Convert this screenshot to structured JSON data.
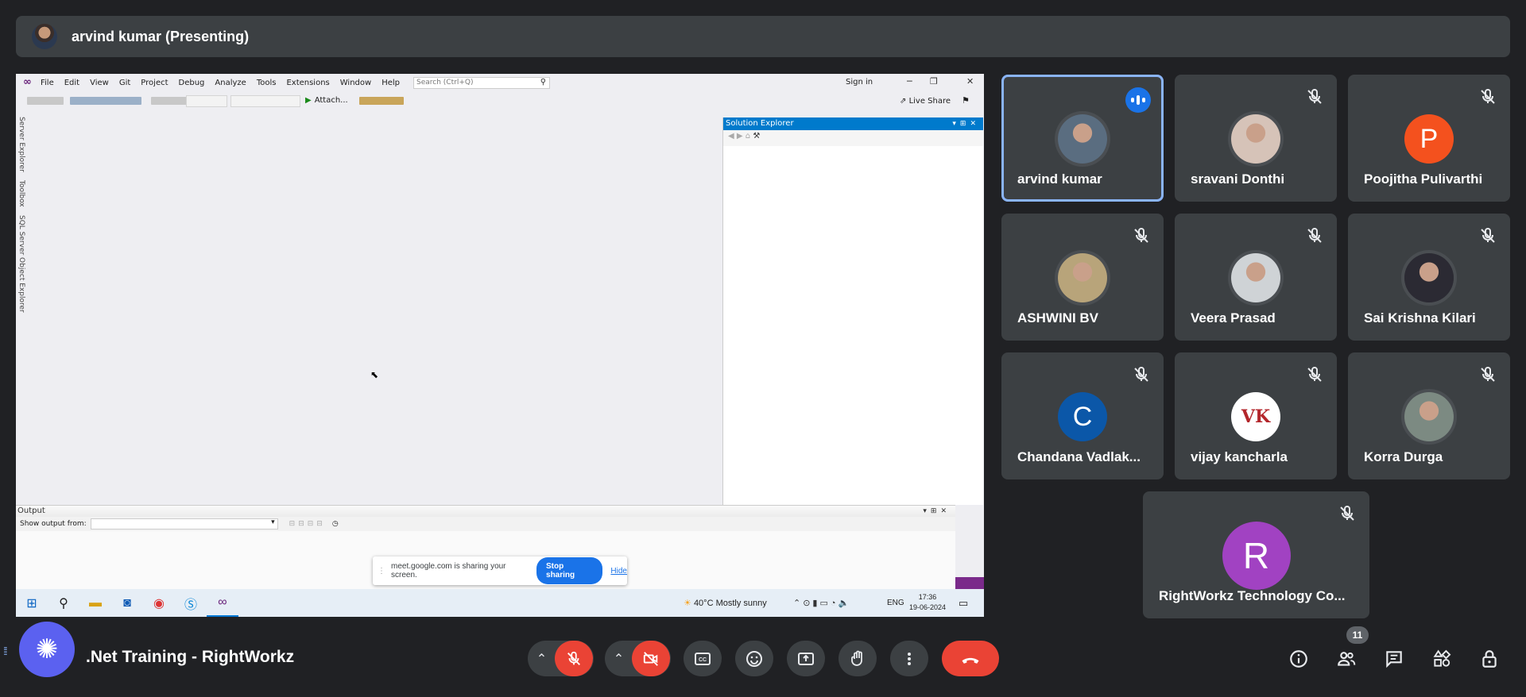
{
  "presenter": {
    "label": "arvind kumar (Presenting)"
  },
  "vs": {
    "menu": [
      "File",
      "Edit",
      "View",
      "Git",
      "Project",
      "Debug",
      "Analyze",
      "Tools",
      "Extensions",
      "Window",
      "Help"
    ],
    "search_placeholder": "Search (Ctrl+Q)",
    "sign_in": "Sign in",
    "attach": "Attach...",
    "live_share": "Live Share",
    "side_tabs": [
      "Server Explorer",
      "Toolbox",
      "SQL Server Object Explorer"
    ],
    "solution_explorer_title": "Solution Explorer",
    "output_title": "Output",
    "show_output_from": "Show output from:"
  },
  "share_notice": {
    "text": "meet.google.com is sharing your screen.",
    "stop_label": "Stop sharing",
    "hide_label": "Hide"
  },
  "taskbar": {
    "weather_temp": "40°C",
    "weather_text": "Mostly sunny",
    "language": "ENG",
    "time": "17:36",
    "date": "19-06-2024"
  },
  "participants": [
    {
      "name": "arvind kumar",
      "speaking": true,
      "avatar": "photo",
      "color": "#5a6d80"
    },
    {
      "name": "sravani Donthi",
      "speaking": false,
      "avatar": "photo",
      "color": "#d6c3b8"
    },
    {
      "name": "Poojitha Pulivarthi",
      "speaking": false,
      "avatar": "letter",
      "letter": "P",
      "color": "#f4511e"
    },
    {
      "name": "ASHWINI BV",
      "speaking": false,
      "avatar": "photo",
      "color": "#b8a47a"
    },
    {
      "name": "Veera Prasad",
      "speaking": false,
      "avatar": "photo",
      "color": "#cfd3d6"
    },
    {
      "name": "Sai Krishna Kilari",
      "speaking": false,
      "avatar": "photo",
      "color": "#2b2a33"
    },
    {
      "name": "Chandana Vadlak...",
      "speaking": false,
      "avatar": "letter",
      "letter": "C",
      "color": "#0b57a8"
    },
    {
      "name": "vijay kancharla",
      "speaking": false,
      "avatar": "logo",
      "letter": "VK",
      "color": "#ffffff"
    },
    {
      "name": "Korra Durga",
      "speaking": false,
      "avatar": "photo",
      "color": "#7c8a82"
    },
    {
      "name": "RightWorkz Technology Co...",
      "speaking": false,
      "avatar": "letter",
      "letter": "R",
      "color": "#a142c2"
    }
  ],
  "meeting": {
    "title": ".Net Training - RightWorkz",
    "people_count": "11"
  },
  "colors": {
    "background": "#202124",
    "tile": "#3c4043",
    "danger": "#ea4335",
    "accent": "#1a73e8",
    "badge": "#5b61f0"
  }
}
